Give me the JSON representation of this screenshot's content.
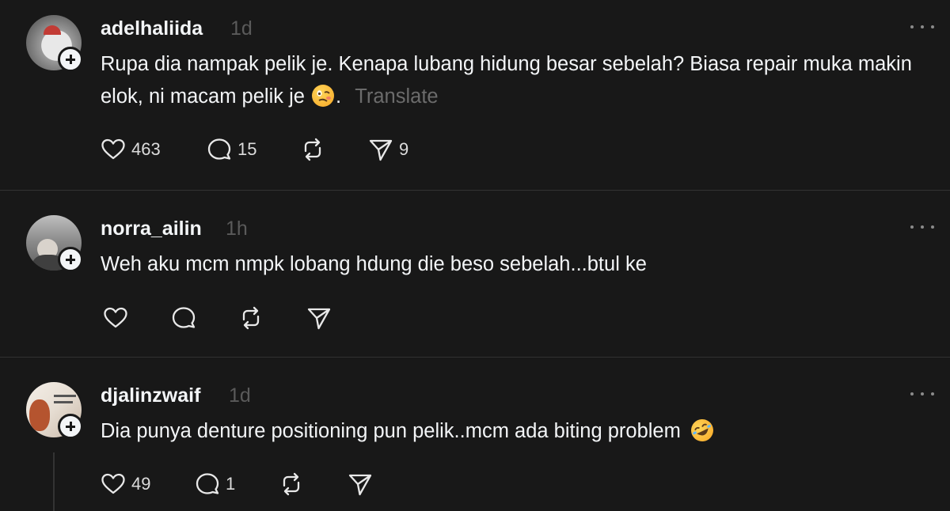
{
  "posts": [
    {
      "username": "adelhaliida",
      "time": "1d",
      "text": "Rupa dia nampak pelik je. Kenapa lubang hidung besar sebelah? Biasa repair muka makin elok, ni macam pelik je",
      "emoji": "woozy-face",
      "text_suffix": ".",
      "translate": "Translate",
      "likes": "463",
      "replies": "15",
      "shares": "9"
    },
    {
      "username": "norra_ailin",
      "time": "1h",
      "text": "Weh aku mcm nmpk lobang hdung die beso sebelah...btul ke"
    },
    {
      "username": "djalinzwaif",
      "time": "1d",
      "text": "Dia punya denture positioning pun pelik..mcm ada biting problem",
      "emoji": "rofl-face",
      "likes": "49",
      "replies": "1"
    }
  ],
  "icons": {
    "like": "heart-icon",
    "reply": "comment-icon",
    "repost": "repost-icon",
    "share": "send-icon",
    "more": "more-icon",
    "follow": "plus-icon"
  },
  "colors": {
    "background": "#181818",
    "text": "#f3f5f7",
    "muted": "#6b6b6b",
    "divider": "#323232"
  }
}
